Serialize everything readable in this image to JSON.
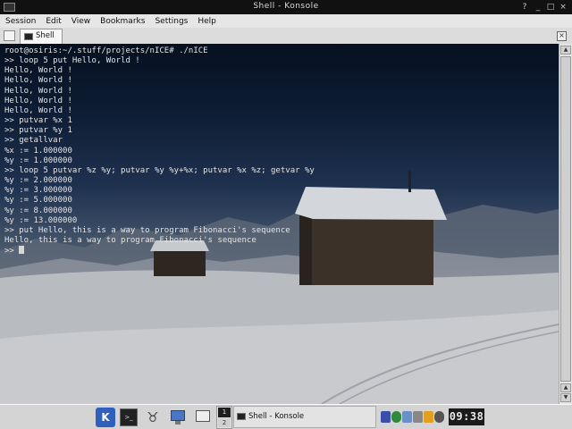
{
  "window": {
    "title": "Shell - Konsole"
  },
  "menu": {
    "items": [
      "Session",
      "Edit",
      "View",
      "Bookmarks",
      "Settings",
      "Help"
    ]
  },
  "tabs": {
    "active_label": "Shell"
  },
  "terminal": {
    "lines": [
      "root@osiris:~/.stuff/projects/nICE# ./nICE",
      ">> loop 5 put Hello, World !",
      "Hello, World !",
      "Hello, World !",
      "Hello, World !",
      "Hello, World !",
      "Hello, World !",
      ">> putvar %x 1",
      ">> putvar %y 1",
      ">> getallvar",
      "%x := 1.000000",
      "%y := 1.000000",
      ">> loop 5 putvar %z %y; putvar %y %y+%x; putvar %x %z; getvar %y",
      "%y := 2.000000",
      "%y := 3.000000",
      "%y := 5.000000",
      "%y := 8.000000",
      "%y := 13.000000",
      ">> put Hello, this is a way to program Fibonacci's sequence",
      "Hello, this is a way to program Fibonacci's sequence"
    ],
    "prompt": ">> "
  },
  "taskbar": {
    "kmenu_label": "K",
    "pager_desktops": [
      "1",
      "2"
    ],
    "task_label": "Shell - Konsole",
    "clock": "09:38",
    "gnu_glyph": "♉",
    "colors": {
      "kmenu": "#2f5fbf",
      "clock_bg": "#1a1a1a"
    }
  }
}
